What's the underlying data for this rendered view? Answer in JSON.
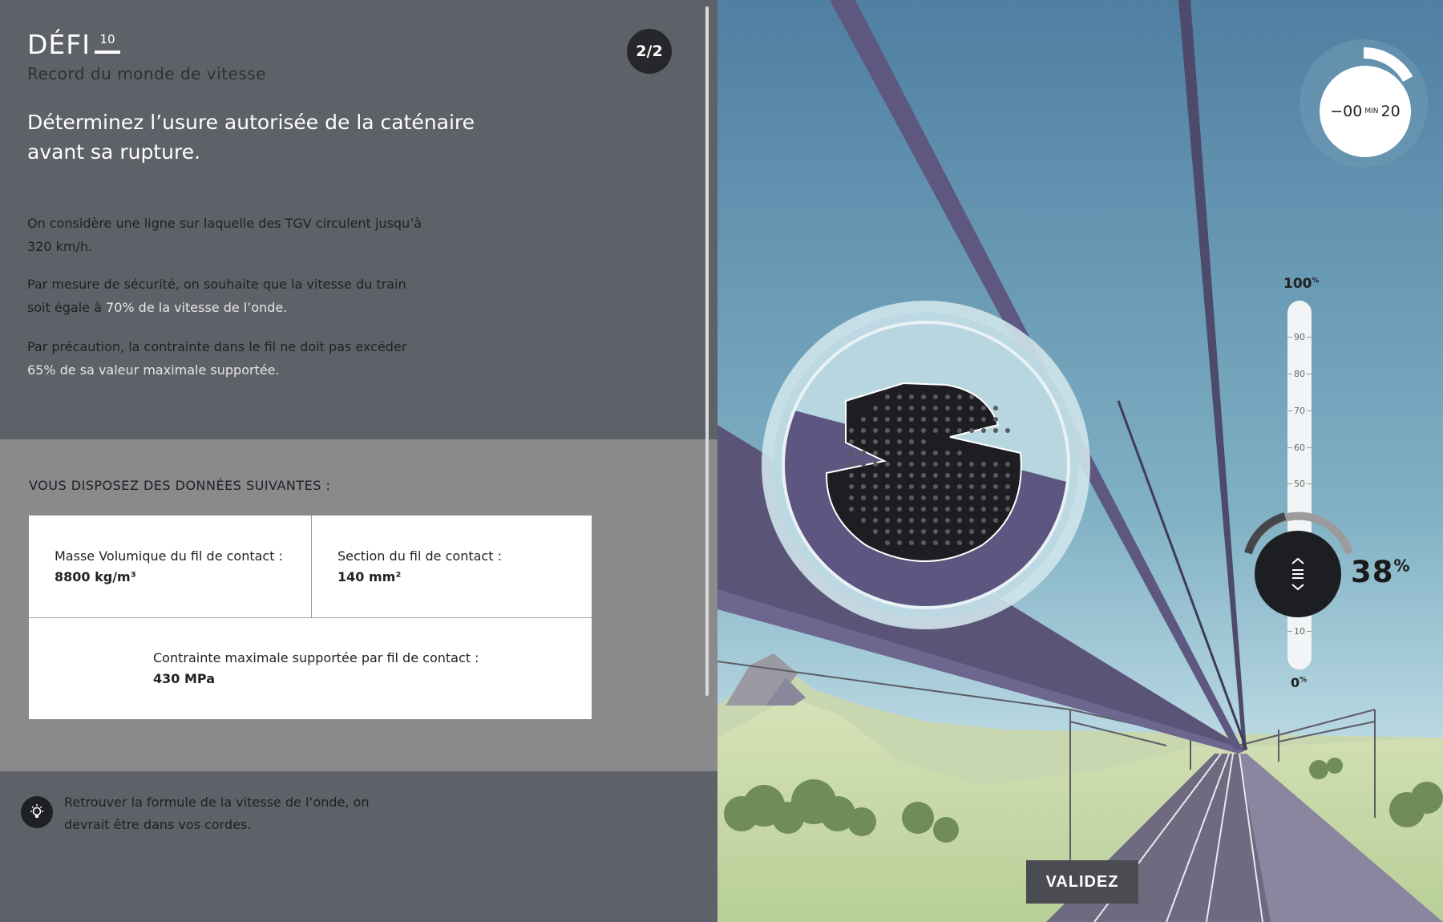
{
  "challenge": {
    "title": "DÉFI",
    "number": "10",
    "subtitle": "Record du monde de vitesse",
    "page_indicator": "2/2",
    "question": "Déterminez l’usure autorisée de la caténaire avant sa rupture."
  },
  "paragraphs": {
    "p1": "On considère une ligne sur laquelle des TGV circulent jusqu’à 320 km/h.",
    "p2_a": "Par mesure de sécurité, on souhaite que la vitesse du train soit égale à",
    "p2_hl": "70% de la vitesse de l’onde.",
    "p3_a": "Par précaution, la contrainte dans le fil ne doit pas excéder",
    "p3_hl": "65% de sa valeur maximale supportée."
  },
  "data_section": {
    "heading": "VOUS DISPOSEZ DES DONNÉES SUIVANTES :",
    "cell1_label": "Masse Volumique du fil de contact :",
    "cell1_value": "8800 kg/m³",
    "cell2_label": "Section du fil de contact :",
    "cell2_value": "140 mm²",
    "cell3_label": "Contrainte maximale supportée par fil de contact :",
    "cell3_value": "430 MPa"
  },
  "hint": {
    "icon": "lightbulb-icon",
    "text": "Retrouver la formule de la vitesse de l’onde, on devrait être dans vos cordes."
  },
  "timer": {
    "prefix": "−00",
    "unit": "MIN",
    "seconds": "20",
    "remaining_fraction": 0.17
  },
  "gauge": {
    "max_label": "100",
    "min_label": "0",
    "percent_sign": "%",
    "ticks": [
      "90",
      "80",
      "70",
      "60",
      "50",
      "10"
    ],
    "value": "38",
    "value_fraction": 0.38,
    "knob_icon": "drag-handle-icon"
  },
  "actions": {
    "validate_label": "VALIDEZ"
  },
  "colors": {
    "panel_dark": "#5e6167",
    "panel_light": "#8a8a8c",
    "sky_top": "#4f7fa1",
    "sky_bottom": "#b9d8e2",
    "catenary_purple": "#5a5478",
    "ground_green": "#c9d8a8"
  }
}
